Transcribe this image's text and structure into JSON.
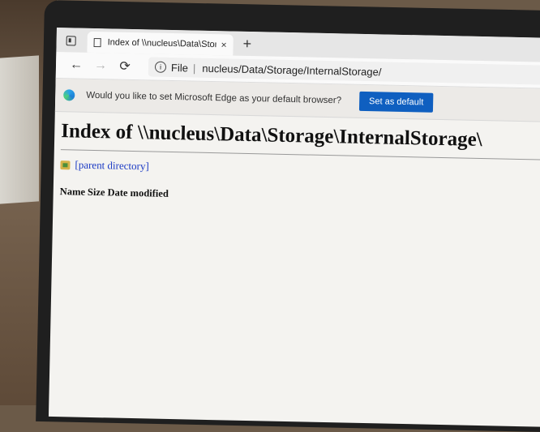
{
  "browser": {
    "tab": {
      "title": "Index of \\\\nucleus\\Data\\Storage\\",
      "close": "×",
      "new_tab": "+"
    },
    "toolbar": {
      "back": "←",
      "forward": "→",
      "refresh": "⟳",
      "scheme": "File",
      "url": "nucleus/Data/Storage/InternalStorage/"
    },
    "infobar": {
      "message": "Would you like to set Microsoft Edge as your default browser?",
      "button": "Set as default"
    }
  },
  "page": {
    "heading": "Index of \\\\nucleus\\Data\\Storage\\InternalStorage\\",
    "parent_link": "[parent directory]",
    "columns": [
      "Name",
      "Size",
      "Date modified"
    ]
  }
}
